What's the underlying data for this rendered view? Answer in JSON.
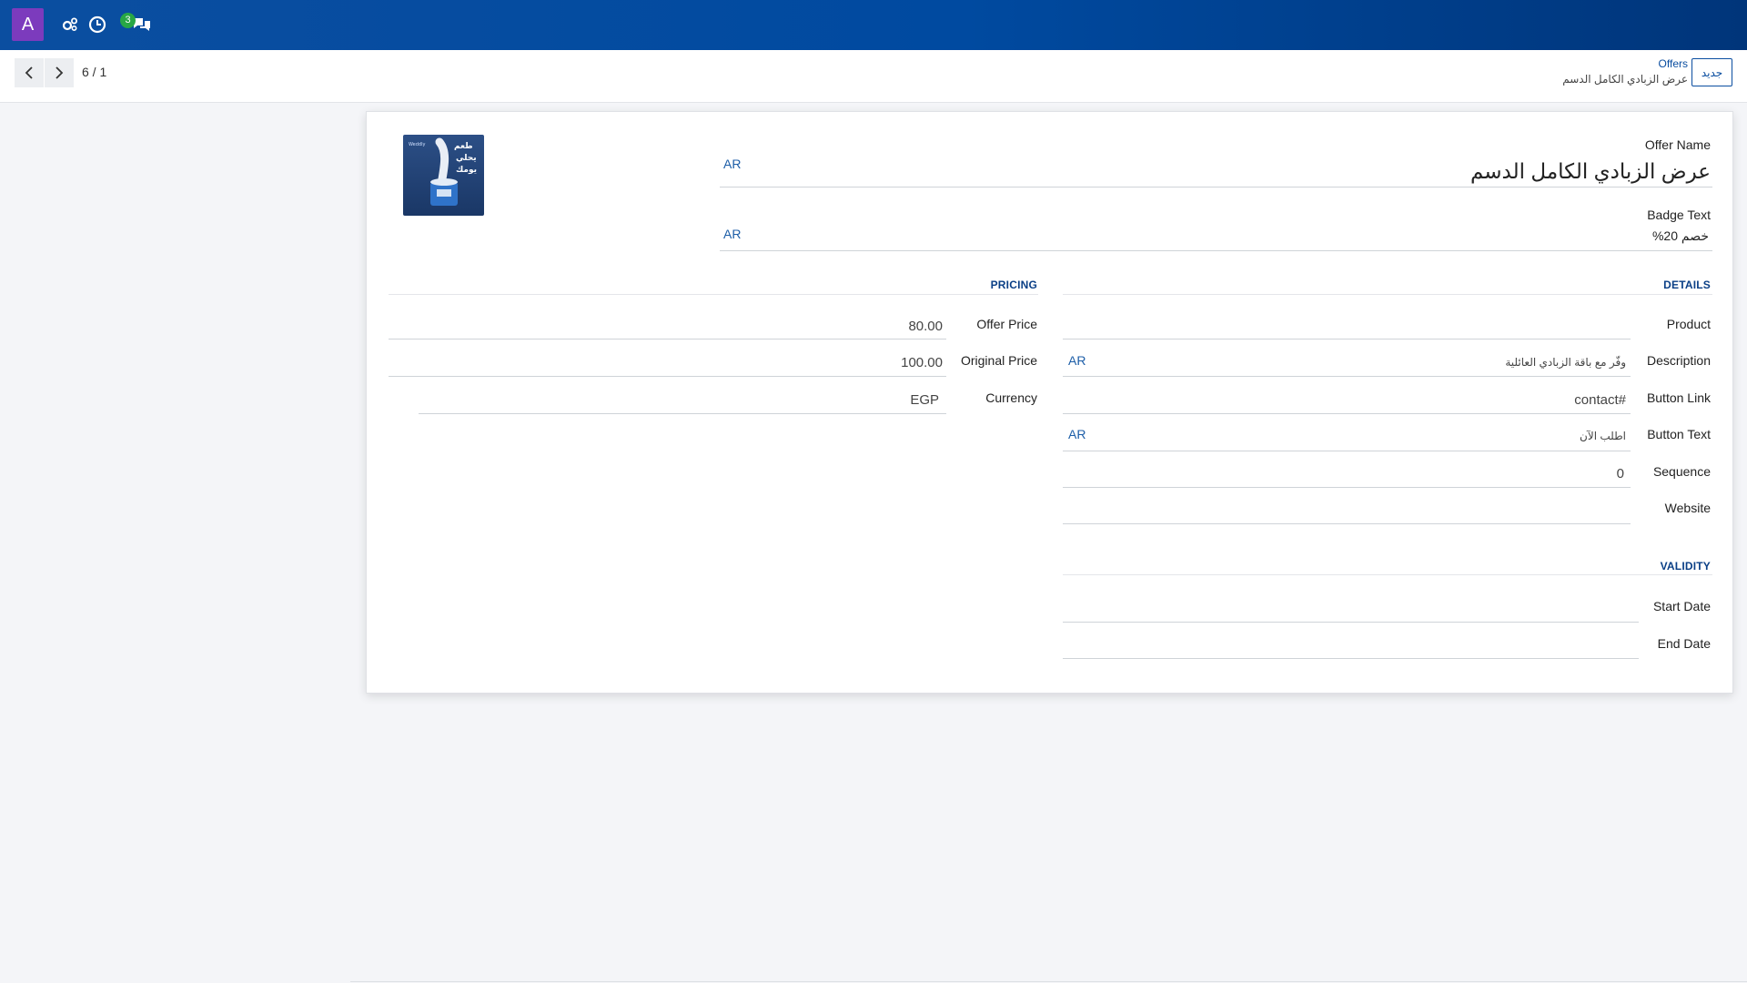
{
  "navbar": {
    "avatar_letter": "A",
    "icons": [
      "settings-icon",
      "clock-icon",
      "chat-icon"
    ],
    "messages_badge": "3",
    "colors": {
      "navbar": "#0b4ea0",
      "avatar": "#7c3bbd",
      "badge": "#28a745"
    }
  },
  "controlbar": {
    "new_label": "جديد",
    "breadcrumb_parent": "Offers",
    "breadcrumb_current": "عرض الزبادي الكامل الدسم",
    "pager_value": "6 / 1"
  },
  "form": {
    "offer_name": {
      "label": "Offer Name",
      "value": "عرض الزبادي الكامل الدسم",
      "lang": "AR"
    },
    "badge_text": {
      "label": "Badge Text",
      "value": "خصم 20%",
      "lang": "AR"
    },
    "details": {
      "title": "DETAILS",
      "product": {
        "label": "Product",
        "value": ""
      },
      "description": {
        "label": "Description",
        "value": "وفّر مع باقة الزبادي العائلية",
        "lang": "AR"
      },
      "button_link": {
        "label": "Button Link",
        "value": "contact#"
      },
      "button_text": {
        "label": "Button Text",
        "value": "اطلب الآن",
        "lang": "AR"
      },
      "sequence": {
        "label": "Sequence",
        "value": "0"
      },
      "website": {
        "label": "Website",
        "value": ""
      }
    },
    "pricing": {
      "title": "PRICING",
      "offer_price": {
        "label": "Offer Price",
        "value": "80.00"
      },
      "original_price": {
        "label": "Original Price",
        "value": "100.00"
      },
      "currency": {
        "label": "Currency",
        "value": "EGP"
      }
    },
    "validity": {
      "title": "VALIDITY",
      "start_date": {
        "label": "Start Date",
        "value": ""
      },
      "end_date": {
        "label": "End Date",
        "value": ""
      }
    },
    "image": {
      "brand_text": "طعم يحلي يومك",
      "small_text": "Weddly"
    }
  }
}
